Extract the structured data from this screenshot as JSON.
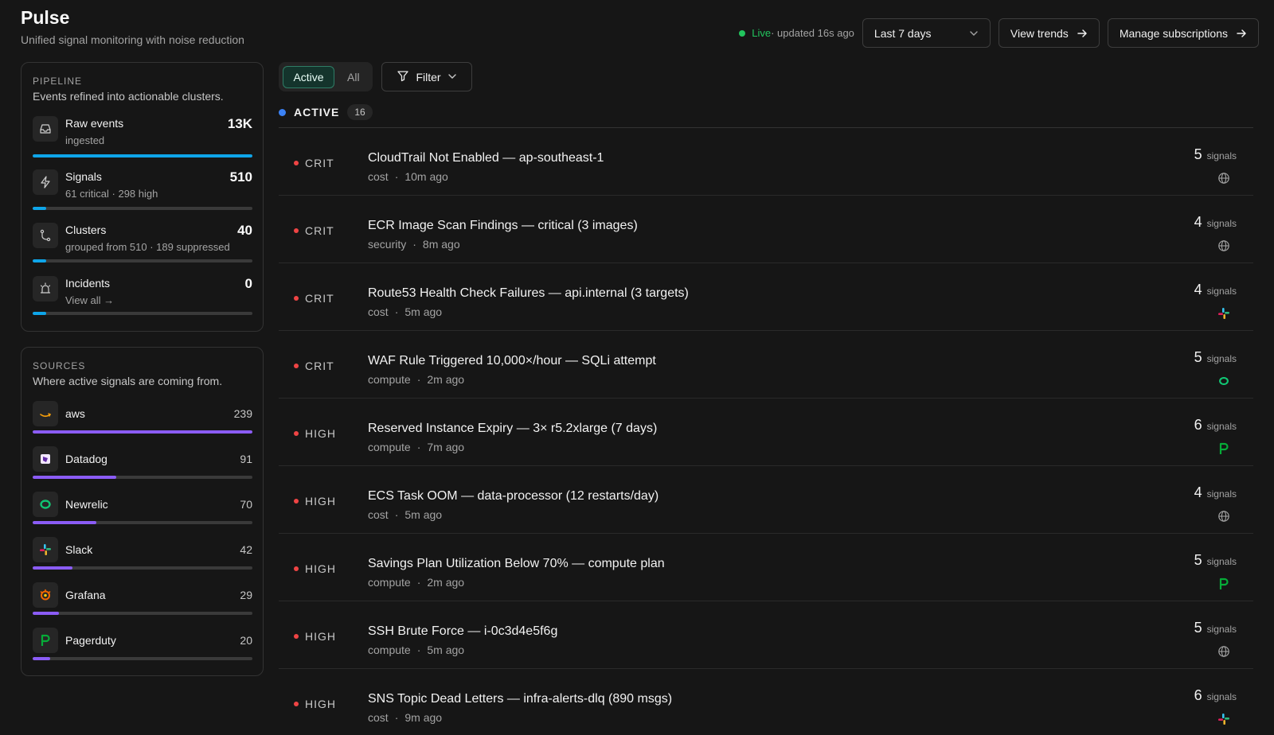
{
  "app": {
    "title": "Pulse",
    "subtitle": "Unified signal monitoring with noise reduction"
  },
  "header": {
    "live_word": "Live",
    "live_text": " · updated 16s ago",
    "range_label": "Last 7 days",
    "view_trends_label": "View trends",
    "manage_label": "Manage subscriptions"
  },
  "pipeline": {
    "label": "PIPELINE",
    "description": "Events refined into actionable clusters.",
    "rows": [
      {
        "name": "Raw events",
        "sub": "ingested",
        "value": "13K",
        "fill": 1.0
      },
      {
        "name": "Signals",
        "sub": "61 critical · 298 high",
        "value": "510",
        "fill": 0.06
      },
      {
        "name": "Clusters",
        "sub": "grouped from 510 · 189 suppressed",
        "value": "40",
        "fill": 0.06
      },
      {
        "name": "Incidents",
        "sub": "View all →",
        "value": "0",
        "fill": 0.06
      }
    ]
  },
  "sources": {
    "label": "SOURCES",
    "description": "Where active signals are coming from.",
    "rows": [
      {
        "name": "aws",
        "value": "239",
        "fill": 1.0,
        "icon": "aws-icon"
      },
      {
        "name": "Datadog",
        "value": "91",
        "fill": 0.38,
        "icon": "datadog-icon"
      },
      {
        "name": "Newrelic",
        "value": "70",
        "fill": 0.29,
        "icon": "newrelic-icon"
      },
      {
        "name": "Slack",
        "value": "42",
        "fill": 0.18,
        "icon": "slack-icon"
      },
      {
        "name": "Grafana",
        "value": "29",
        "fill": 0.12,
        "icon": "grafana-icon"
      },
      {
        "name": "Pagerduty",
        "value": "20",
        "fill": 0.08,
        "icon": "pagerduty-icon"
      }
    ]
  },
  "filters": {
    "active_label": "Active",
    "all_label": "All",
    "filter_label": "Filter"
  },
  "section": {
    "label": "ACTIVE",
    "count": "16"
  },
  "signals_word": "signals",
  "items": [
    {
      "severity": "CRIT",
      "title": "CloudTrail Not Enabled — ap-southeast-1",
      "category": "cost",
      "time": "10m ago",
      "count": "5",
      "source": "globe-icon"
    },
    {
      "severity": "CRIT",
      "title": "ECR Image Scan Findings — critical (3 images)",
      "category": "security",
      "time": "8m ago",
      "count": "4",
      "source": "globe-icon"
    },
    {
      "severity": "CRIT",
      "title": "Route53 Health Check Failures — api.internal (3 targets)",
      "category": "cost",
      "time": "5m ago",
      "count": "4",
      "source": "slack-icon"
    },
    {
      "severity": "CRIT",
      "title": "WAF Rule Triggered 10,000×/hour — SQLi attempt",
      "category": "compute",
      "time": "2m ago",
      "count": "5",
      "source": "newrelic-icon"
    },
    {
      "severity": "HIGH",
      "title": "Reserved Instance Expiry — 3× r5.2xlarge (7 days)",
      "category": "compute",
      "time": "7m ago",
      "count": "6",
      "source": "pagerduty-icon"
    },
    {
      "severity": "HIGH",
      "title": "ECS Task OOM — data-processor (12 restarts/day)",
      "category": "cost",
      "time": "5m ago",
      "count": "4",
      "source": "globe-icon"
    },
    {
      "severity": "HIGH",
      "title": "Savings Plan Utilization Below 70% — compute plan",
      "category": "compute",
      "time": "2m ago",
      "count": "5",
      "source": "pagerduty-icon"
    },
    {
      "severity": "HIGH",
      "title": "SSH Brute Force — i-0c3d4e5f6g",
      "category": "compute",
      "time": "5m ago",
      "count": "5",
      "source": "globe-icon"
    },
    {
      "severity": "HIGH",
      "title": "SNS Topic Dead Letters — infra-alerts-dlq (890 msgs)",
      "category": "cost",
      "time": "9m ago",
      "count": "6",
      "source": "slack-icon"
    }
  ],
  "colors": {
    "accent_green": "#22c55e",
    "active_blue": "#3b82f6",
    "crit_red": "#ef4444",
    "pipeline_bar": "#0ea5e9",
    "source_bar": "#8b5cf6"
  }
}
